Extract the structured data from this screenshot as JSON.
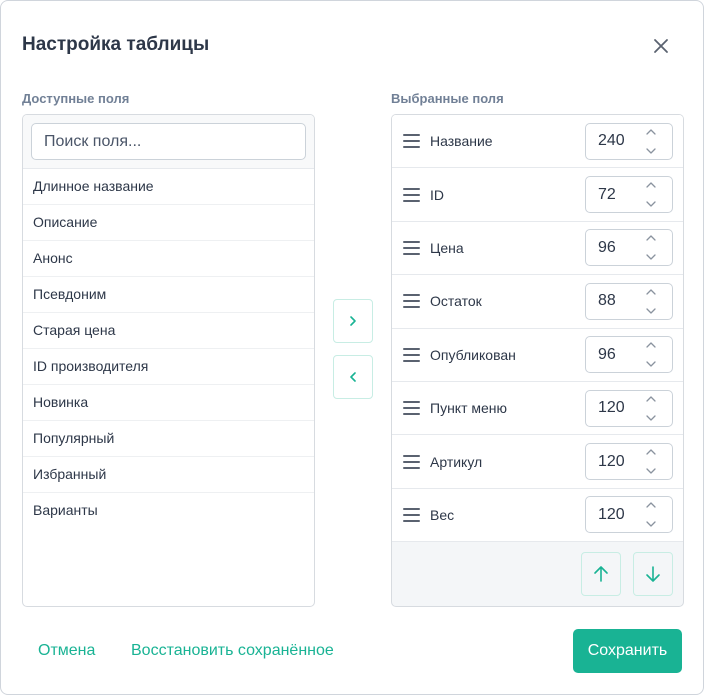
{
  "dialog": {
    "title": "Настройка таблицы"
  },
  "available": {
    "label": "Доступные поля",
    "search_placeholder": "Поиск поля...",
    "items": [
      "Длинное название",
      "Описание",
      "Анонс",
      "Псевдоним",
      "Старая цена",
      "ID производителя",
      "Новинка",
      "Популярный",
      "Избранный",
      "Варианты"
    ]
  },
  "selected": {
    "label": "Выбранные поля",
    "items": [
      {
        "label": "Название",
        "width": "240"
      },
      {
        "label": "ID",
        "width": "72"
      },
      {
        "label": "Цена",
        "width": "96"
      },
      {
        "label": "Остаток",
        "width": "88"
      },
      {
        "label": "Опубликован",
        "width": "96"
      },
      {
        "label": "Пункт меню",
        "width": "120"
      },
      {
        "label": "Артикул",
        "width": "120"
      },
      {
        "label": "Вес",
        "width": "120"
      }
    ]
  },
  "footer": {
    "cancel_label": "Отмена",
    "restore_label": "Восстановить сохранённое",
    "save_label": "Сохранить"
  },
  "icons": {
    "close": "close-icon",
    "move_right": "chevron-right-icon",
    "move_left": "chevron-left-icon",
    "drag": "drag-handle-icon",
    "spin_up": "chevron-up-icon",
    "spin_down": "chevron-down-icon",
    "move_up": "arrow-up-icon",
    "move_down": "arrow-down-icon"
  },
  "colors": {
    "accent": "#19b394",
    "text": "#2d3748",
    "muted": "#718096",
    "border": "#d7dbe0"
  }
}
